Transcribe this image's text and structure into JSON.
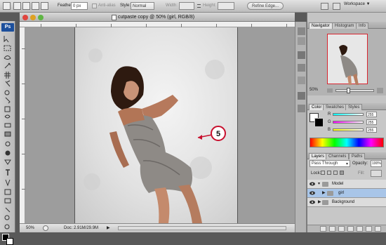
{
  "options_bar": {
    "feather_label": "Feather:",
    "feather_value": "0 px",
    "antialias_label": "Anti-alias",
    "style_label": "Style:",
    "style_value": "Normal",
    "width_label": "Width:",
    "height_label": "Height:",
    "refine_edge_label": "Refine Edge...",
    "workspace_label": "Workspace"
  },
  "document": {
    "title": "cutpaste copy @ 50% (girl, RGB/8)",
    "annotation_number": "5"
  },
  "status": {
    "zoom": "50%",
    "doc_info": "Doc: 2.91M/29.9M"
  },
  "navigator": {
    "tabs": [
      "Navigator",
      "Histogram",
      "Info"
    ],
    "zoom": "50%"
  },
  "color_panel": {
    "tabs": [
      "Color",
      "Swatches",
      "Styles"
    ],
    "channels": [
      {
        "label": "R",
        "value": "255"
      },
      {
        "label": "G",
        "value": "255"
      },
      {
        "label": "B",
        "value": "255"
      }
    ]
  },
  "layers_panel": {
    "tabs": [
      "Layers",
      "Channels",
      "Paths"
    ],
    "blend_mode": "Pass Through",
    "opacity_label": "Opacity:",
    "opacity_value": "100%",
    "lock_label": "Lock:",
    "fill_label": "Fill:",
    "layers": [
      {
        "name": "Model",
        "kind": "group"
      },
      {
        "name": "girl",
        "kind": "group"
      },
      {
        "name": "Background",
        "kind": "group"
      }
    ]
  },
  "tools": {
    "ps_logo": "Ps"
  },
  "colors": {
    "accent_red": "#c8102e",
    "selected_layer": "#a8c5e8",
    "brand_blue": "#1c4f9c"
  }
}
